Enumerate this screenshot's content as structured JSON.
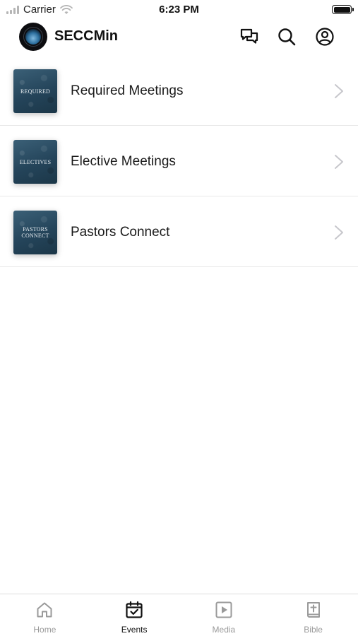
{
  "status_bar": {
    "carrier": "Carrier",
    "time": "6:23 PM"
  },
  "header": {
    "app_title": "SECCMin",
    "icons": [
      "chat-icon",
      "search-icon",
      "profile-icon"
    ]
  },
  "events": [
    {
      "title": "Required Meetings",
      "thumb_text": "REQUIRED"
    },
    {
      "title": "Elective Meetings",
      "thumb_text": "ELECTIVES"
    },
    {
      "title": "Pastors Connect",
      "thumb_text": "PASTORS CONNECT"
    }
  ],
  "tabs": [
    {
      "label": "Home",
      "icon": "home-icon",
      "active": false
    },
    {
      "label": "Events",
      "icon": "calendar-icon",
      "active": true
    },
    {
      "label": "Media",
      "icon": "play-icon",
      "active": false
    },
    {
      "label": "Bible",
      "icon": "bible-icon",
      "active": false
    }
  ],
  "colors": {
    "active_tab": "#111111",
    "inactive_tab": "#9a9a9a",
    "thumb_bg": "#2b4b60"
  }
}
